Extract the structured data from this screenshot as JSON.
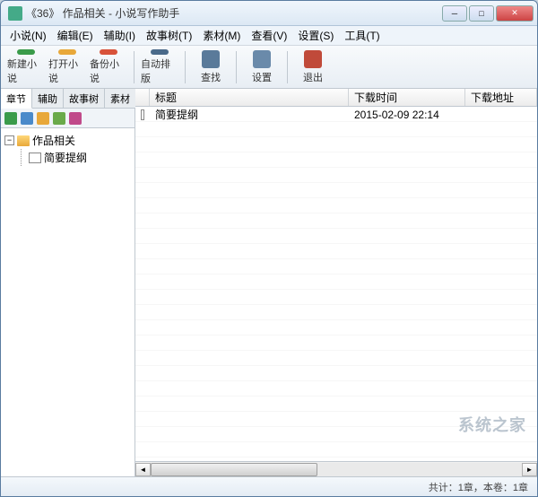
{
  "window": {
    "title": "《36》 作品相关 - 小说写作助手"
  },
  "menu": {
    "novel": "小说(N)",
    "edit": "编辑(E)",
    "assist": "辅助(I)",
    "storytree": "故事树(T)",
    "material": "素材(M)",
    "view": "查看(V)",
    "settings": "设置(S)",
    "tools": "工具(T)"
  },
  "toolbar": {
    "new_novel": "新建小说",
    "open_novel": "打开小说",
    "backup_novel": "备份小说",
    "auto_typeset": "自动排版",
    "search": "查找",
    "settings": "设置",
    "exit": "退出"
  },
  "side_tabs": {
    "chapter": "章节",
    "assist": "辅助",
    "storytree": "故事树",
    "material": "素材"
  },
  "tree": {
    "root": "作品相关",
    "child1": "简要提纲"
  },
  "list": {
    "col_title": "标题",
    "col_time": "下载时间",
    "col_url": "下载地址",
    "row1_title": "简要提纲",
    "row1_time": "2015-02-09 22:14"
  },
  "status": {
    "text": "共计：1章，本卷：1章"
  },
  "watermark": "系统之家",
  "colors": {
    "new_icon": "#3a9b4a",
    "open_icon": "#e8a83a",
    "backup_icon": "#d8523a",
    "typeset_icon": "#4a6a8a",
    "search_icon": "#5a7a9a",
    "settings_icon": "#6a8aaa",
    "exit_icon": "#c04a3a"
  }
}
